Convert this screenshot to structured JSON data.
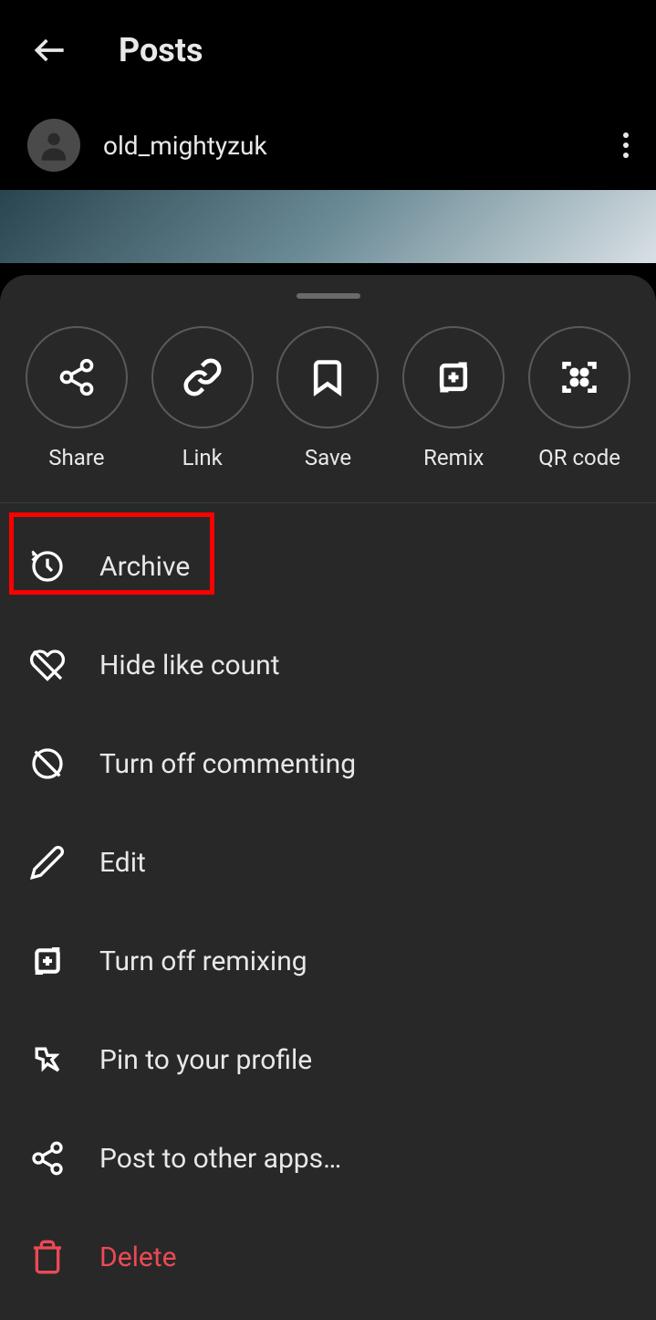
{
  "header": {
    "title": "Posts"
  },
  "user": {
    "username": "old_mightyzuk"
  },
  "actions": {
    "share": "Share",
    "link": "Link",
    "save": "Save",
    "remix": "Remix",
    "qrcode": "QR code"
  },
  "menu": {
    "archive": "Archive",
    "hideLikes": "Hide like count",
    "turnOffComments": "Turn off commenting",
    "edit": "Edit",
    "turnOffRemix": "Turn off remixing",
    "pin": "Pin to your profile",
    "postOther": "Post to other apps…",
    "delete": "Delete"
  }
}
